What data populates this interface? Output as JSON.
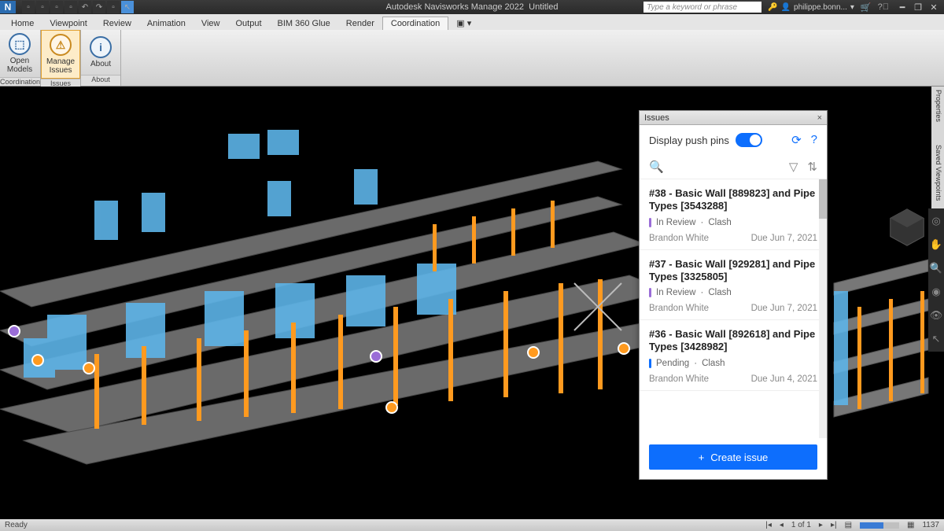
{
  "app": {
    "title": "Autodesk Navisworks Manage 2022",
    "doc": "Untitled",
    "search_placeholder": "Type a keyword or phrase",
    "user": "philippe.bonn..."
  },
  "menu": {
    "tabs": [
      "Home",
      "Viewpoint",
      "Review",
      "Animation",
      "View",
      "Output",
      "BIM 360 Glue",
      "Render",
      "Coordination"
    ],
    "active": "Coordination"
  },
  "ribbon": {
    "panels": [
      {
        "label": "Coordination",
        "buttons": [
          {
            "icon": "⬚",
            "label": "Open Models"
          }
        ]
      },
      {
        "label": "Issues",
        "buttons": [
          {
            "icon": "⚠",
            "label": "Manage Issues",
            "active": true
          }
        ]
      },
      {
        "label": "About",
        "buttons": [
          {
            "icon": "i",
            "label": "About"
          }
        ]
      }
    ]
  },
  "issues_panel": {
    "title": "Issues",
    "display_push_pins_label": "Display push pins",
    "display_push_pins": true,
    "create_label": "Create issue",
    "issues": [
      {
        "id": "#38",
        "title": "#38 - Basic Wall [889823] and Pipe Types [3543288]",
        "status": "In Review",
        "type": "Clash",
        "assignee": "Brandon White",
        "due": "Due Jun 7, 2021",
        "status_kind": "rev"
      },
      {
        "id": "#37",
        "title": "#37 - Basic Wall [929281] and Pipe Types [3325805]",
        "status": "In Review",
        "type": "Clash",
        "assignee": "Brandon White",
        "due": "Due Jun 7, 2021",
        "status_kind": "rev"
      },
      {
        "id": "#36",
        "title": "#36 - Basic Wall [892618] and Pipe Types [3428982]",
        "status": "Pending",
        "type": "Clash",
        "assignee": "Brandon White",
        "due": "Due Jun 4, 2021",
        "status_kind": "pen"
      }
    ]
  },
  "status": {
    "left": "Ready",
    "page": "1 of 1",
    "right_num": "1137"
  },
  "side_tabs": [
    "Properties",
    "Saved Viewpoints"
  ]
}
